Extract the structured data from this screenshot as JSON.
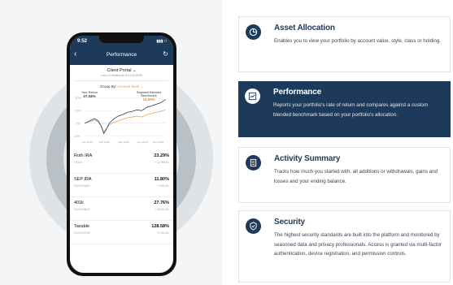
{
  "phone": {
    "status_time": "9:52",
    "status_icons": "▮▮▮ □",
    "title": "Performance",
    "portal": "Client Portal ⌄",
    "portal_sub": "Last 12 Months as of 11/11/2020",
    "group_by_label": "Group By:",
    "group_by_value": "Account level ⌄",
    "your_return_label": "Your Return",
    "your_return_value": "27.34%",
    "benchmark_label": "Segment Blended Benchmark",
    "benchmark_value": "16.59%",
    "chart": {
      "y_ticks": [
        "40%",
        "20%",
        "0%",
        "-20%"
      ],
      "x_ticks": [
        "Nov 2019",
        "Feb 2020",
        "May 2020",
        "Aug 2020",
        "Nov 2020"
      ]
    },
    "accounts": [
      {
        "name": "Roth IRA",
        "number": "XXXXX",
        "pct": "23.29%",
        "amount": "+ 12,996.DL"
      },
      {
        "name": "SEP IRA",
        "number": "XXXXXX2602",
        "pct": "11.80%",
        "amount": "+ 5,813.DL"
      },
      {
        "name": "401k",
        "number": "XXXXXX5612",
        "pct": "27.76%",
        "amount": "+ 30,812.DL"
      },
      {
        "name": "Taxable",
        "number": "XXXXXX7230",
        "pct": "128.58%",
        "amount": "+ 6,331.DL"
      }
    ]
  },
  "features": [
    {
      "icon": "pie-chart-icon",
      "title": "Asset Allocation",
      "desc": "Enables you to view your portfolio by account value, style, class or holding."
    },
    {
      "icon": "trend-chart-icon",
      "title": "Performance",
      "desc": "Reports your portfolio's rate of return and compares against a custom blended benchmark based on your portfolio's allocation."
    },
    {
      "icon": "document-list-icon",
      "title": "Activity Summary",
      "desc": "Tracks how much you started with, all additions or withdrawals, gains and losses and your ending balance."
    },
    {
      "icon": "shield-check-icon",
      "title": "Security",
      "desc": "The highest security standards are built into the platform and monitored by seasoned data and privacy professionals. Access is granted via multi-factor authentication, device registration, and permission controls."
    }
  ],
  "colors": {
    "navy": "#1e3a5a",
    "orange": "#e8923a",
    "background": "#f4f5f6"
  }
}
